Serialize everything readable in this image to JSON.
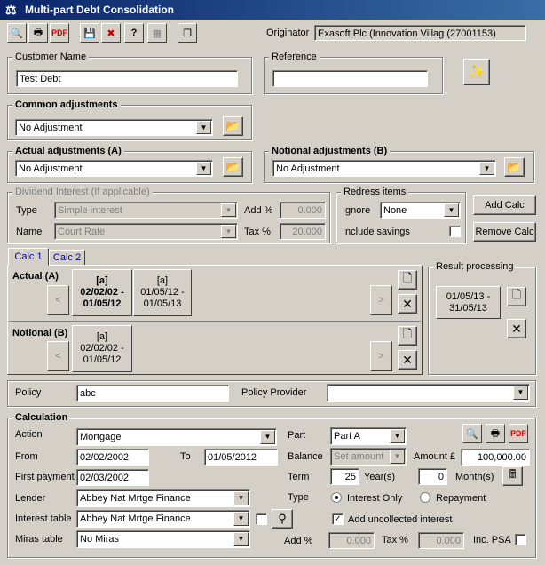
{
  "window": {
    "title": "Multi-part Debt Consolidation"
  },
  "toolbar": {
    "originator_label": "Originator",
    "originator_value": "Exasoft Plc (Innovation Villag (27001153)"
  },
  "customer": {
    "label": "Customer Name",
    "value": "Test Debt"
  },
  "reference": {
    "label": "Reference",
    "value": ""
  },
  "common_adj": {
    "label": "Common adjustments",
    "value": "No Adjustment"
  },
  "actual_adj": {
    "label": "Actual adjustments (A)",
    "value": "No Adjustment"
  },
  "notional_adj": {
    "label": "Notional adjustments (B)",
    "value": "No Adjustment"
  },
  "dividend": {
    "label": "Dividend Interest (If applicable)",
    "type_label": "Type",
    "type_value": "Simple interest",
    "name_label": "Name",
    "name_value": "Court Rate",
    "add_label": "Add %",
    "add_value": "0.000",
    "tax_label": "Tax %",
    "tax_value": "20.000"
  },
  "redress": {
    "label": "Redress items",
    "ignore_label": "Ignore",
    "ignore_value": "None",
    "savings_label": "Include savings"
  },
  "buttons": {
    "add_calc": "Add Calc",
    "remove_calc": "Remove Calc"
  },
  "tabs": [
    {
      "label": "Calc 1"
    },
    {
      "label": "Calc 2"
    }
  ],
  "actual": {
    "label": "Actual (A)",
    "cards": [
      {
        "tag": "[a]",
        "line1": "02/02/02 -",
        "line2": "01/05/12"
      },
      {
        "tag": "[a]",
        "line1": "01/05/12 -",
        "line2": "01/05/13"
      }
    ]
  },
  "notional": {
    "label": "Notional (B)",
    "cards": [
      {
        "tag": "[a]",
        "line1": "02/02/02 -",
        "line2": "01/05/12"
      }
    ]
  },
  "result": {
    "label": "Result processing",
    "line1": "01/05/13 -",
    "line2": "31/05/13"
  },
  "arrows": {
    "prev": "<",
    "next": ">"
  },
  "policy": {
    "label": "Policy",
    "value": "abc",
    "provider_label": "Policy Provider",
    "provider_value": ""
  },
  "calculation": {
    "label": "Calculation",
    "action_label": "Action",
    "action_value": "Mortgage",
    "part_label": "Part",
    "part_value": "Part A",
    "from_label": "From",
    "from_value": "02/02/2002",
    "to_label": "To",
    "to_value": "01/05/2012",
    "balance_label": "Balance",
    "balance_value": "Set amount",
    "amount_label": "Amount £",
    "amount_value": "100,000.00",
    "first_payment_label": "First payment",
    "first_payment_value": "02/03/2002",
    "term_label": "Term",
    "term_years": "25",
    "years_label": "Year(s)",
    "term_months": "0",
    "months_label": "Month(s)",
    "lender_label": "Lender",
    "lender_value": "Abbey Nat Mrtge Finance",
    "type_label": "Type",
    "interest_only_label": "Interest Only",
    "repayment_label": "Repayment",
    "interest_table_label": "Interest table",
    "interest_table_value": "Abbey Nat Mrtge Finance",
    "uncollected_label": "Add uncollected interest",
    "miras_label": "Miras table",
    "miras_value": "No Miras",
    "add_label": "Add %",
    "add_value": "0.000",
    "tax_label": "Tax %",
    "tax_value": "0.000",
    "inc_psa_label": "Inc. PSA"
  }
}
